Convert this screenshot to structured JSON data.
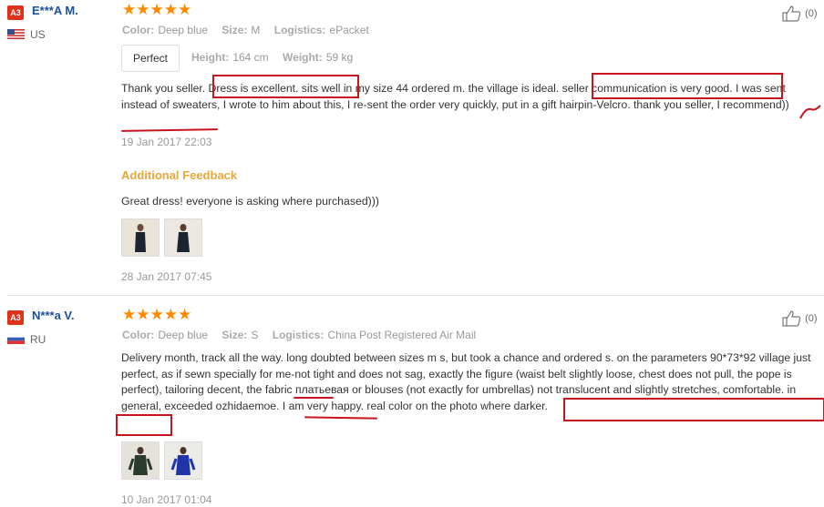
{
  "reviews": [
    {
      "badge": "A3",
      "name": "E***A M.",
      "country": "US",
      "stars": "★★★★★",
      "color_label": "Color:",
      "color_value": "Deep blue",
      "size_label": "Size:",
      "size_value": "M",
      "logistics_label": "Logistics:",
      "logistics_value": "ePacket",
      "tag": "Perfect",
      "height_label": "Height:",
      "height_value": "164 cm",
      "weight_label": "Weight:",
      "weight_value": "59 kg",
      "body": "Thank you seller. Dress is excellent. sits well in my size 44 ordered m. the village is ideal. seller communication is very good. I was sent instead of sweaters, I wrote to him about this, I re-sent the order very quickly, put in a gift hairpin-Velcro. thank you seller, I recommend))",
      "date": "19 Jan 2017 22:03",
      "additional_title": "Additional Feedback",
      "additional_text": "Great dress! everyone is asking where purchased)))",
      "additional_date": "28 Jan 2017 07:45",
      "helpful": "(0)"
    },
    {
      "badge": "A3",
      "name": "N***a V.",
      "country": "RU",
      "stars": "★★★★★",
      "color_label": "Color:",
      "color_value": "Deep blue",
      "size_label": "Size:",
      "size_value": "S",
      "logistics_label": "Logistics:",
      "logistics_value": "China Post Registered Air Mail",
      "body": "Delivery month, track all the way. long doubted between sizes m s, but took a chance and ordered s. on the parameters 90*73*92 village just perfect, as if sewn specially for me-not tight and does not sag, exactly the figure (waist belt slightly loose, chest does not pull, the pope is perfect), tailoring decent, the fabric платьевая or blouses (not exactly for umbrellas) not translucent and slightly stretches, comfortable. in general, exceeded ozhidaemoe. I am very happy. real color on the photo where darker.",
      "date": "10 Jan 2017 01:04",
      "helpful": "(0)"
    }
  ],
  "colors": {
    "accent": "#e0321b",
    "star": "#ff8a00",
    "name": "#1d4f9c",
    "additional": "#e8a73b",
    "annotation": "#c8141c"
  },
  "icons": [
    "thumbs-up-icon",
    "us-flag-icon",
    "ru-flag-icon",
    "photo-thumbnail"
  ]
}
